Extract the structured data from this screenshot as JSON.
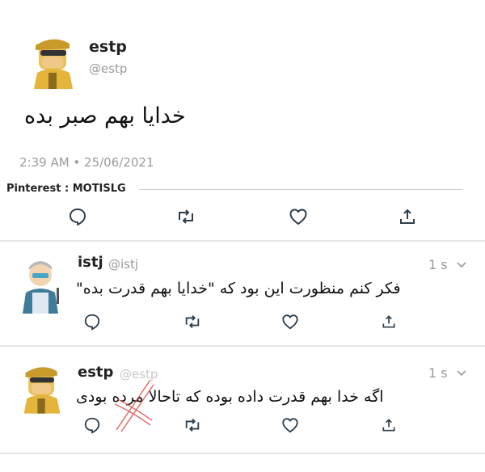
{
  "tweet_main": {
    "name": "estp",
    "handle": "@estp",
    "text": "خدایا بهم صبر بده",
    "timestamp": "2:39 AM • 25/06/2021"
  },
  "watermark": "Pinterest : MOTISLG",
  "reply1": {
    "name": "istj",
    "handle": "@istj",
    "time": "1 s",
    "text": "فکر کنم منظورت این بود که \"خدایا بهم قدرت بده\""
  },
  "reply2": {
    "name": "estp",
    "handle": "@estp",
    "time": "1 s",
    "text": "اگه خدا بهم قدرت داده بوده که تاحالا مرده بودی"
  },
  "icons": [
    "reply-icon",
    "retweet-icon",
    "like-icon",
    "share-icon",
    "chevron-down-icon"
  ],
  "colors": {
    "icon": "#2f3e4c",
    "muted": "#9a9a9a",
    "strike": "#d9534f",
    "divider": "#e6e6e6"
  }
}
